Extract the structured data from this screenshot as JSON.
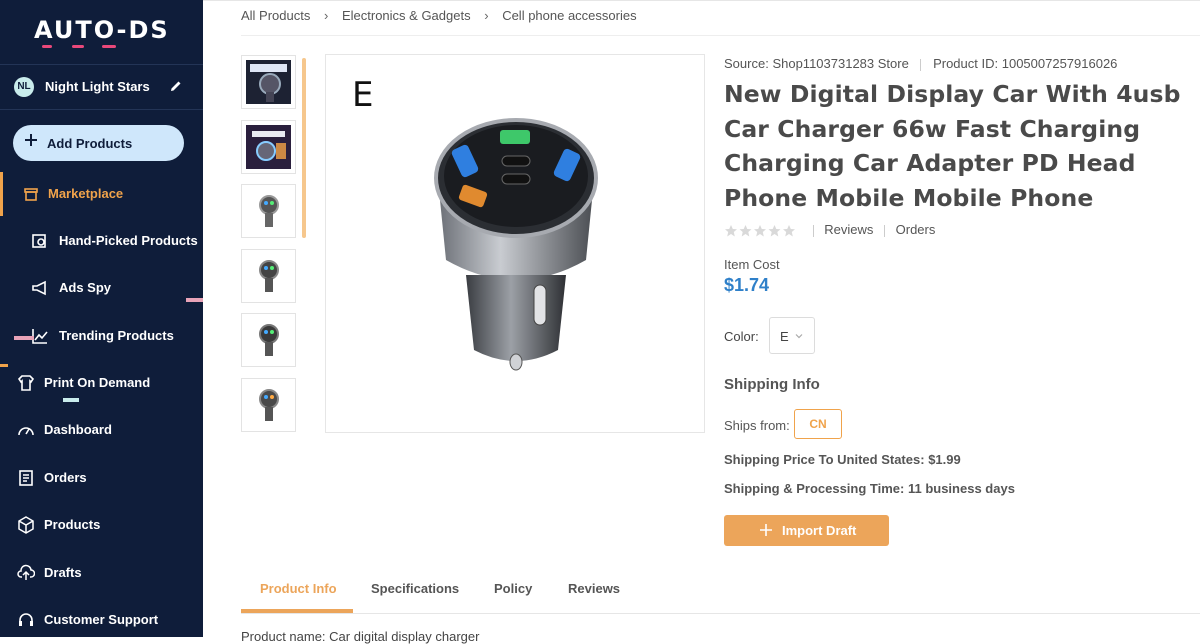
{
  "brand": {
    "logo_text": "AUTO-DS",
    "accent": "#f0a34b",
    "sidebar_bg": "#0f1d3a",
    "price_color": "#2f80c9"
  },
  "store": {
    "initials": "NL",
    "name": "Night Light Stars",
    "edit_icon": "pencil-icon"
  },
  "sidebar": {
    "add_products_label": "Add Products",
    "items": [
      {
        "label": "Marketplace",
        "icon": "store-icon",
        "active": true
      },
      {
        "label": "Hand-Picked Products",
        "icon": "hand-picked-icon"
      },
      {
        "label": "Ads Spy",
        "icon": "megaphone-icon"
      },
      {
        "label": "Trending Products",
        "icon": "trending-chart-icon"
      },
      {
        "label": "Print On Demand",
        "icon": "shirt-icon"
      },
      {
        "label": "Dashboard",
        "icon": "gauge-icon"
      },
      {
        "label": "Orders",
        "icon": "receipt-icon"
      },
      {
        "label": "Products",
        "icon": "box-icon"
      },
      {
        "label": "Drafts",
        "icon": "cloud-upload-icon"
      },
      {
        "label": "Customer Support",
        "icon": "headset-icon"
      }
    ]
  },
  "breadcrumb": [
    "All Products",
    "Electronics & Gadgets",
    "Cell phone accessories"
  ],
  "product": {
    "source_label": "Source:",
    "source": "Shop1103731283 Store",
    "id_label": "Product ID:",
    "id": "1005007257916026",
    "title": "New Digital Display Car With 4usb Car Charger 66w Fast Charging Charging Car Adapter PD Head Phone Mobile Mobile Phone",
    "rating_stars": 0,
    "reviews_label": "Reviews",
    "orders_label": "Orders",
    "item_cost_label": "Item Cost",
    "item_cost": "$1.74",
    "color_label": "Color:",
    "color_value": "E",
    "image_variant_letter": "E"
  },
  "shipping": {
    "heading": "Shipping Info",
    "ships_from_label": "Ships from:",
    "ships_from": "CN",
    "price_label": "Shipping Price To United States:",
    "price": "$1.99",
    "time_label": "Shipping & Processing Time:",
    "time": "11 business days"
  },
  "actions": {
    "import_label": "Import Draft"
  },
  "tabs": [
    "Product Info",
    "Specifications",
    "Policy",
    "Reviews"
  ],
  "active_tab": "Product Info",
  "description_first_line": "Product name: Car digital display charger"
}
